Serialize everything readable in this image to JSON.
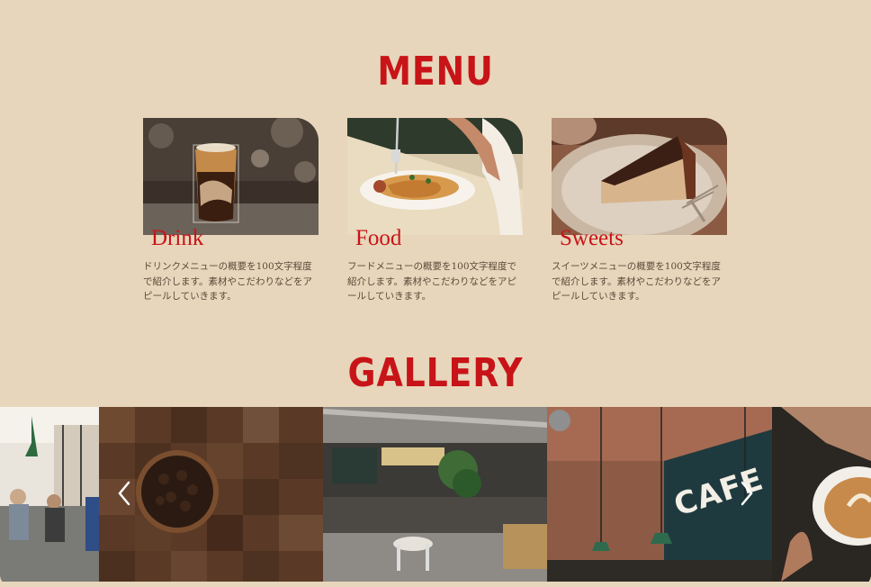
{
  "menu": {
    "title": "MENU",
    "items": [
      {
        "name": "Drink",
        "description": "ドリンクメニューの概要を100文字程度で紹介します。素材やこだわりなどをアピールしていきます。"
      },
      {
        "name": "Food",
        "description": "フードメニューの概要を100文字程度で紹介します。素材やこだわりなどをアピールしていきます。"
      },
      {
        "name": "Sweets",
        "description": "スイーツメニューの概要を100文字程度で紹介します。素材やこだわりなどをアピールしていきます。"
      }
    ]
  },
  "gallery": {
    "title": "GALLERY",
    "cafe_sign": "CAFE",
    "prev_icon": "chevron-left-icon",
    "next_icon": "chevron-right-icon"
  },
  "colors": {
    "background": "#e7d6bb",
    "accent": "#c81418",
    "text": "#5b4a3a"
  }
}
